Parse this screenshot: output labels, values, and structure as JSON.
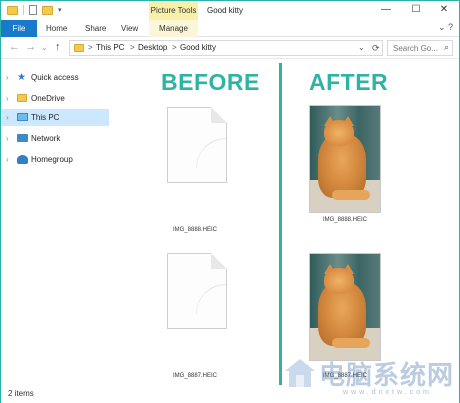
{
  "window": {
    "title": "Good kitty",
    "context_tab": "Picture Tools",
    "controls": {
      "minimize": "—",
      "maximize": "☐",
      "close": "✕"
    }
  },
  "ribbon": {
    "tabs": [
      "File",
      "Home",
      "Share",
      "View",
      "Manage"
    ],
    "help": "⌄ ?"
  },
  "address": {
    "crumbs": [
      "This PC",
      "Desktop",
      "Good kitty"
    ],
    "separator": ">",
    "search_placeholder": "Search Go...",
    "refresh": "⟳",
    "dropdown": "⌄"
  },
  "nav": {
    "items": [
      {
        "label": "Quick access",
        "icon": "star-icon",
        "selected": false
      },
      {
        "label": "OneDrive",
        "icon": "folder-icon",
        "selected": false
      },
      {
        "label": "This PC",
        "icon": "computer-icon",
        "selected": true
      },
      {
        "label": "Network",
        "icon": "network-icon",
        "selected": false
      },
      {
        "label": "Homegroup",
        "icon": "homegroup-icon",
        "selected": false
      }
    ]
  },
  "content": {
    "before_label": "BEFORE",
    "after_label": "AFTER",
    "before_files": [
      "IMG_8888.HEIC",
      "IMG_8887.HEIC"
    ],
    "after_files": [
      "IMG_8888.HEIC",
      "IMG_8887.HEIC"
    ],
    "accent_color": "#2fb3a5"
  },
  "status": {
    "items": "2 items",
    "views": "▦ ☰"
  },
  "watermark": {
    "text": "电脑系统网",
    "url": "www.dnxtw.com"
  }
}
